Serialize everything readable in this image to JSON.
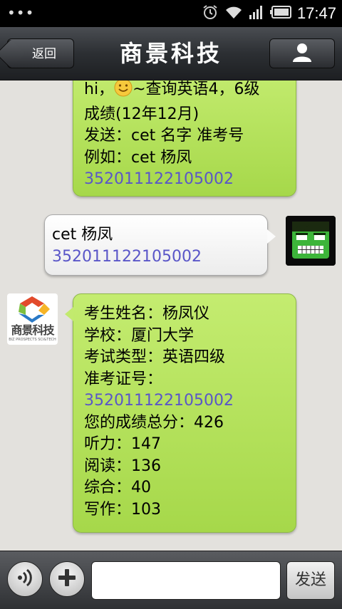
{
  "status_bar": {
    "time": "17:47",
    "menu_dots": "•••",
    "icons": [
      "alarm-icon",
      "wifi-icon",
      "signal-icon",
      "battery-icon"
    ]
  },
  "header": {
    "title": "商景科技",
    "back_label": "返回",
    "profile_icon": "person-icon"
  },
  "messages": [
    {
      "sender": "bot",
      "lines": [
        {
          "text": "hi，",
          "emoji": "smile-emoji-icon",
          "after": "~查询英语4，6级"
        },
        {
          "text": "成绩(12年12月)"
        },
        {
          "text": "发送：cet 名字 准考号"
        },
        {
          "text": "例如：cet 杨凤"
        },
        {
          "text": "352011122105002",
          "link": true
        }
      ]
    },
    {
      "sender": "user",
      "lines": [
        {
          "text": "cet 杨凤"
        },
        {
          "text": "352011122105002",
          "link": true
        }
      ]
    },
    {
      "sender": "bot",
      "lines": [
        {
          "text": "考生姓名：杨凤仪"
        },
        {
          "text": "学校：厦门大学"
        },
        {
          "text": "考试类型：英语四级"
        },
        {
          "text": "准考证号："
        },
        {
          "text": "352011122105002",
          "link": true
        },
        {
          "text": "您的成绩总分：426"
        },
        {
          "text": "听力：147"
        },
        {
          "text": "阅读：136"
        },
        {
          "text": "综合：40"
        },
        {
          "text": "写作：103"
        }
      ]
    }
  ],
  "bot_avatar": {
    "logo_text": "商景科技",
    "logo_subtext": "BIZ PROSPECTS SCI&TECH"
  },
  "input_bar": {
    "voice_icon": "voice-icon",
    "plus_icon": "plus-icon",
    "input_value": "",
    "send_label": "发送"
  },
  "colors": {
    "bubble_green": "#b5e15c",
    "link_blue": "#5a56c8",
    "chat_bg": "#e3e1dd"
  }
}
